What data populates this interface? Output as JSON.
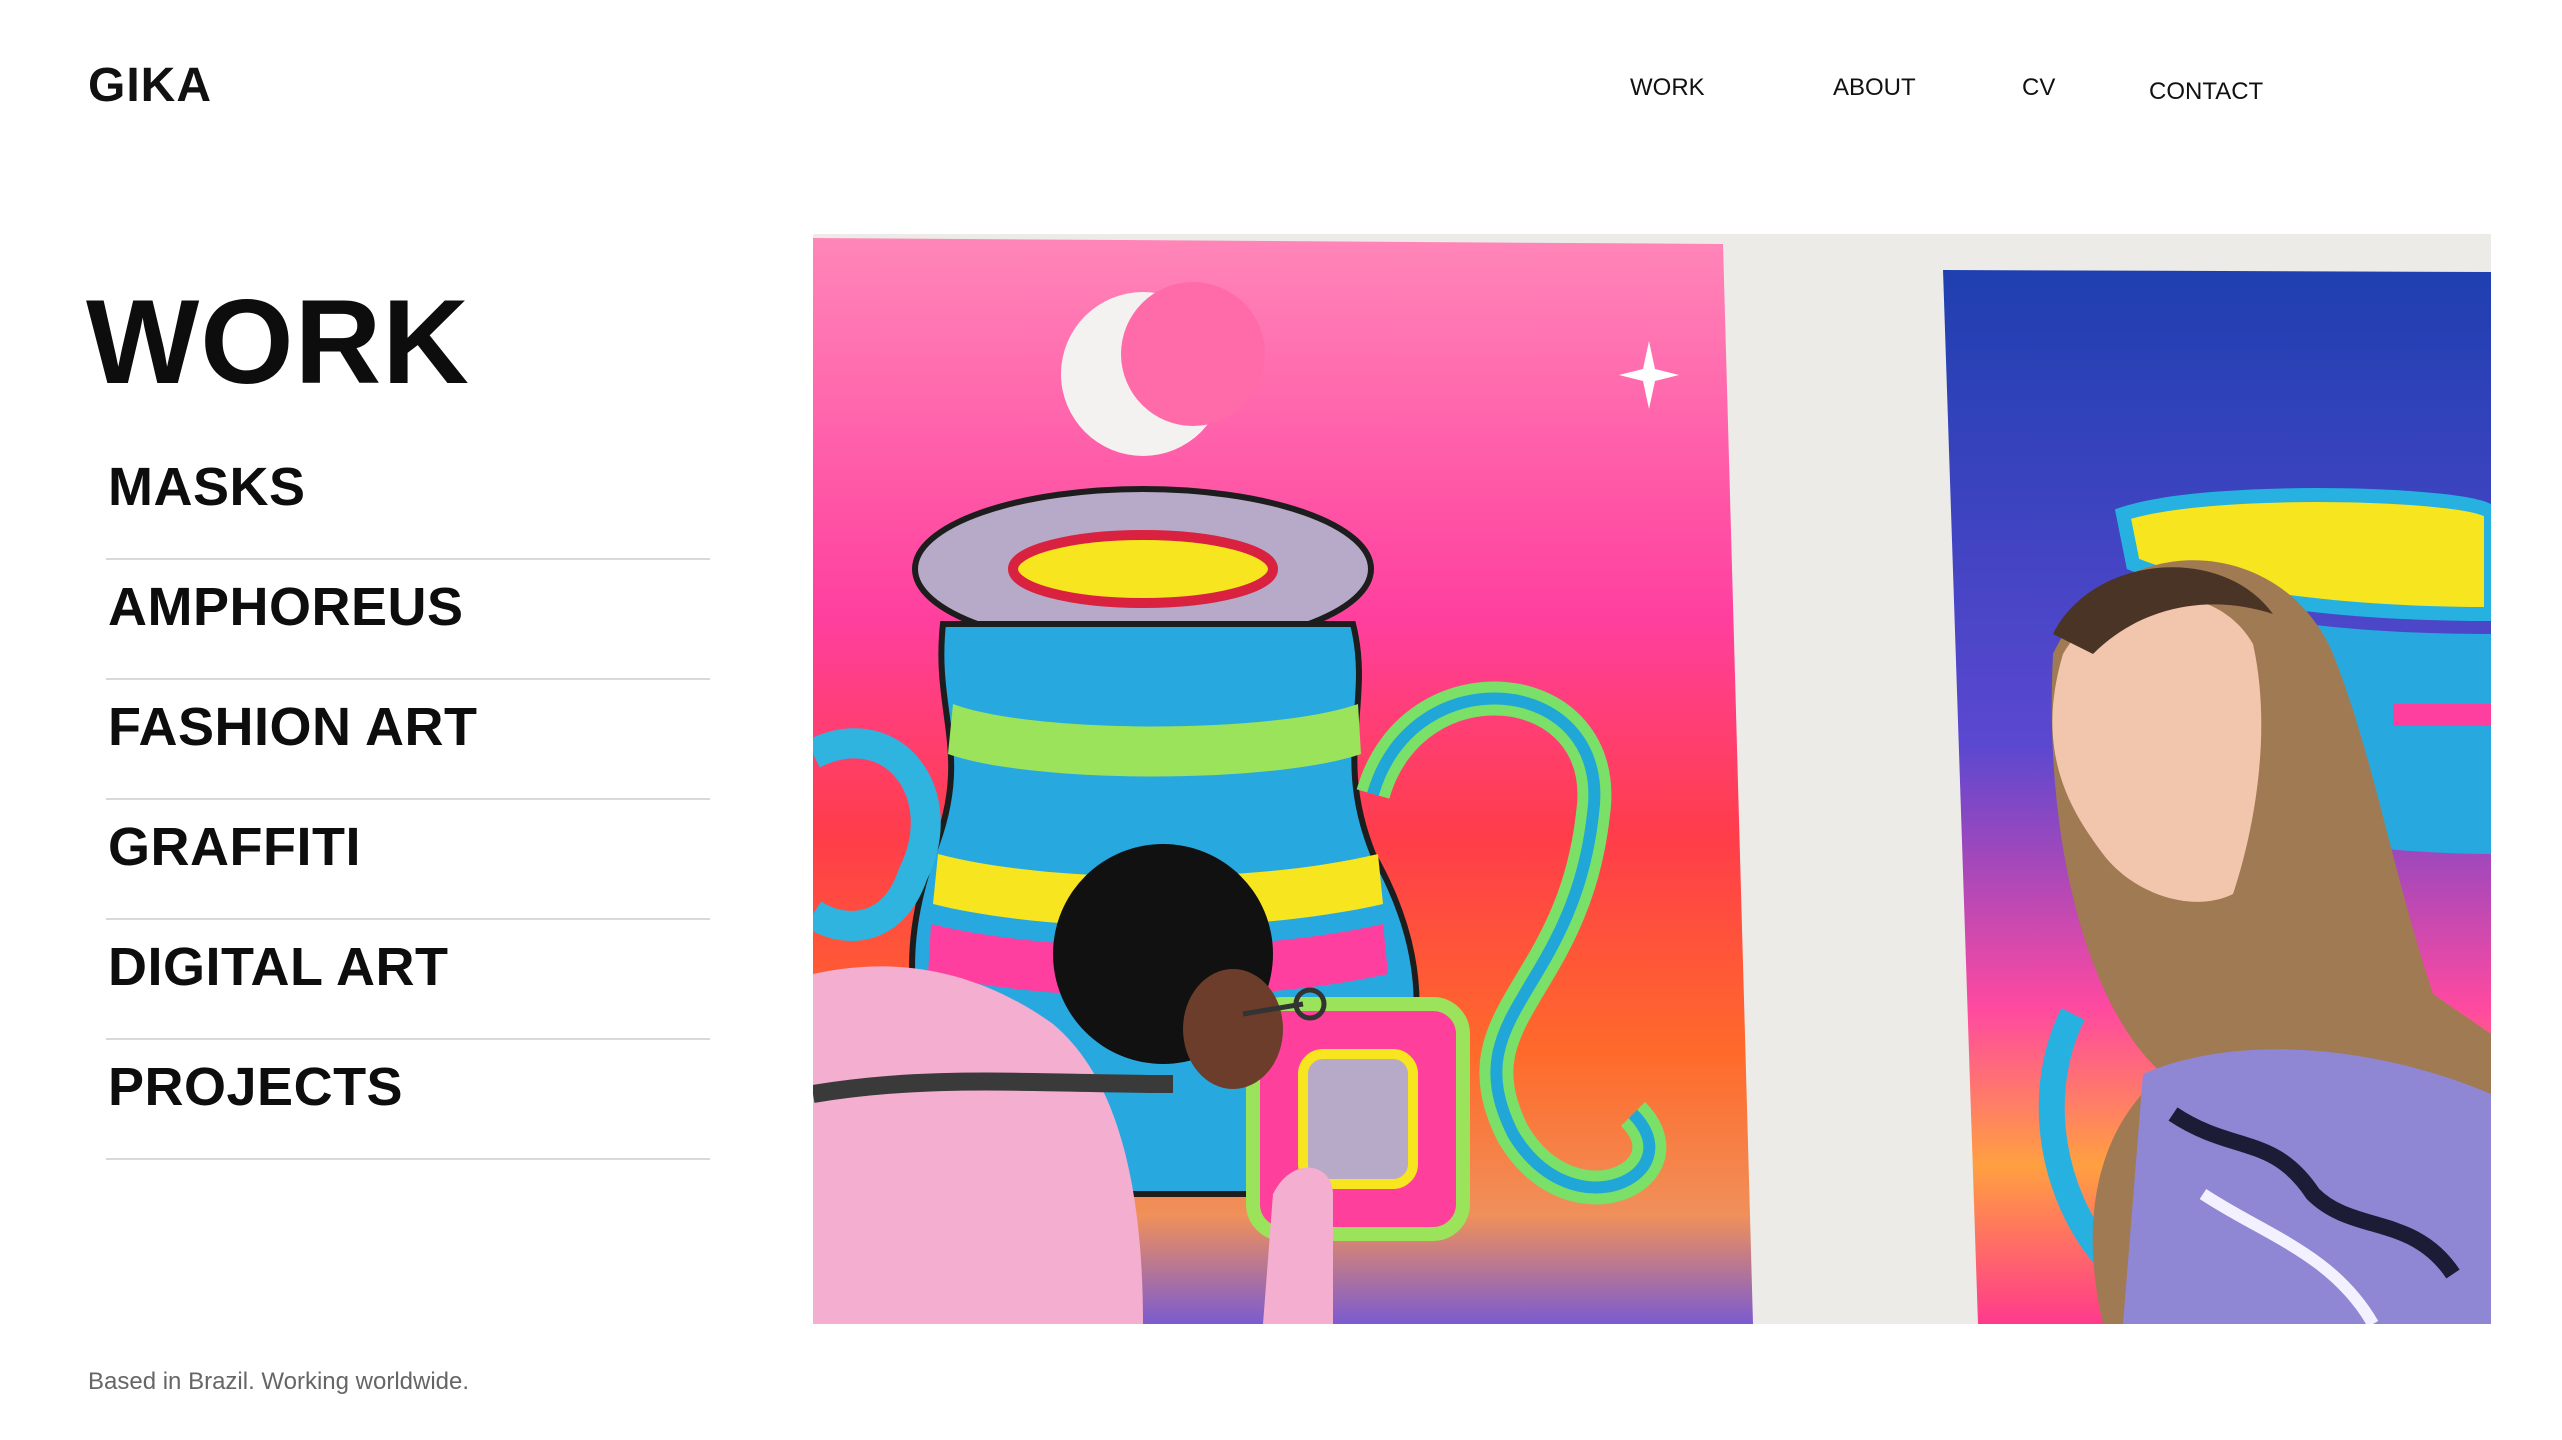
{
  "header": {
    "logo": "GIKA",
    "nav": [
      {
        "label": "WORK"
      },
      {
        "label": "ABOUT"
      },
      {
        "label": "CV"
      },
      {
        "label": "CONTACT"
      }
    ]
  },
  "main": {
    "title": "WORK",
    "categories": [
      {
        "label": "MASKS"
      },
      {
        "label": "AMPHOREUS"
      },
      {
        "label": "FASHION ART"
      },
      {
        "label": "GRAFFITI"
      },
      {
        "label": "DIGITAL ART"
      },
      {
        "label": "PROJECTS"
      }
    ],
    "image": {
      "icon": "artwork-photo"
    }
  },
  "footer": {
    "text": "Based in Brazil. Working worldwide."
  },
  "colors": {
    "text": "#111111",
    "divider": "#d9d9d9",
    "muted": "#666666",
    "background": "#ffffff"
  }
}
